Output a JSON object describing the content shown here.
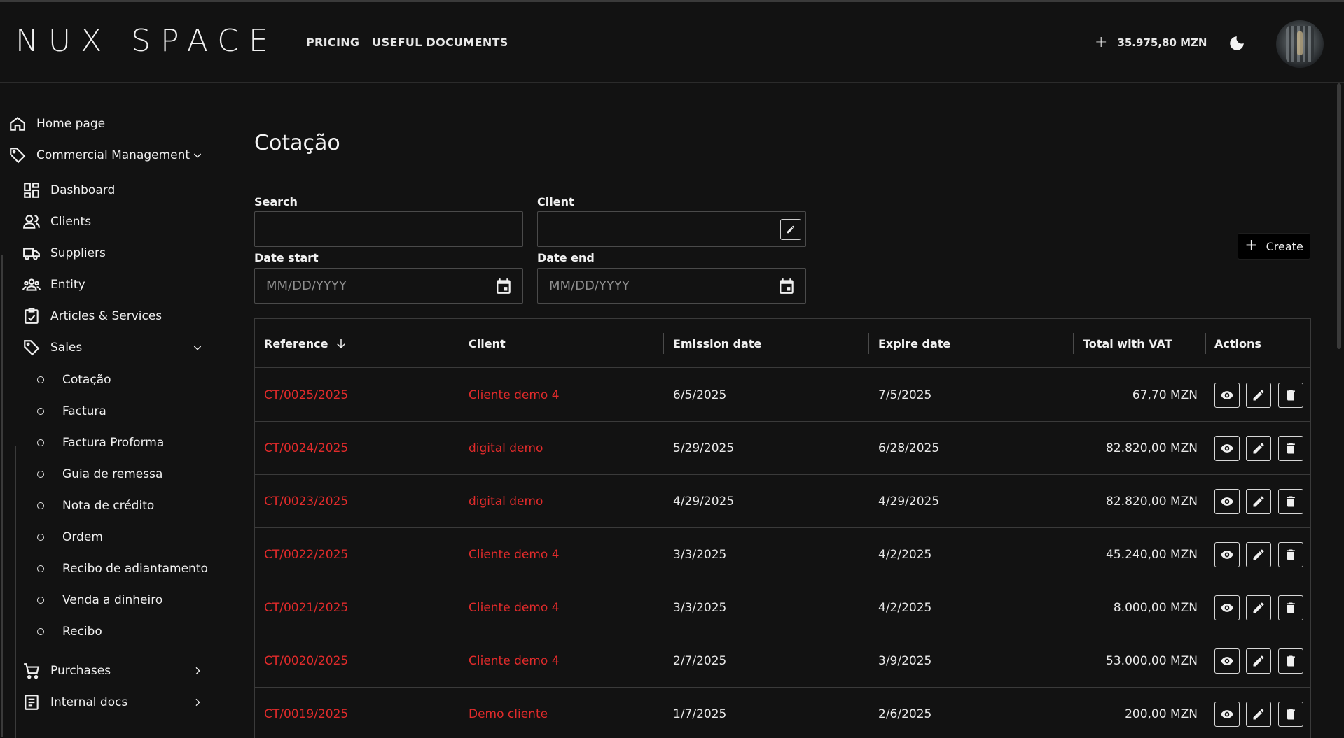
{
  "app": {
    "logo": "NUX SPACE",
    "nav": [
      "PRICING",
      "USEFUL DOCUMENTS"
    ],
    "balance": "35.975,80 MZN"
  },
  "sidebar": {
    "home": "Home page",
    "commercial": "Commercial Management",
    "items": [
      "Dashboard",
      "Clients",
      "Suppliers",
      "Entity",
      "Articles & Services"
    ],
    "sales": "Sales",
    "sales_items": [
      "Cotação",
      "Factura",
      "Factura Proforma",
      "Guia de remessa",
      "Nota de crédito",
      "Ordem",
      "Recibo de adiantamento",
      "Venda a dinheiro",
      "Recibo"
    ],
    "purchases": "Purchases",
    "internal_docs": "Internal docs"
  },
  "page": {
    "title": "Cotação",
    "search_label": "Search",
    "client_label": "Client",
    "date_start_label": "Date start",
    "date_end_label": "Date end",
    "date_placeholder": "MM/DD/YYYY",
    "create_label": "Create"
  },
  "table": {
    "headers": [
      "Reference",
      "Client",
      "Emission date",
      "Expire date",
      "Total with VAT",
      "Actions"
    ],
    "rows": [
      {
        "ref": "CT/0025/2025",
        "client": "Cliente demo 4",
        "emission": "6/5/2025",
        "expire": "7/5/2025",
        "total": "67,70 MZN"
      },
      {
        "ref": "CT/0024/2025",
        "client": "digital demo",
        "emission": "5/29/2025",
        "expire": "6/28/2025",
        "total": "82.820,00 MZN"
      },
      {
        "ref": "CT/0023/2025",
        "client": "digital demo",
        "emission": "4/29/2025",
        "expire": "4/29/2025",
        "total": "82.820,00 MZN"
      },
      {
        "ref": "CT/0022/2025",
        "client": "Cliente demo 4",
        "emission": "3/3/2025",
        "expire": "4/2/2025",
        "total": "45.240,00 MZN"
      },
      {
        "ref": "CT/0021/2025",
        "client": "Cliente demo 4",
        "emission": "3/3/2025",
        "expire": "4/2/2025",
        "total": "8.000,00 MZN"
      },
      {
        "ref": "CT/0020/2025",
        "client": "Cliente demo 4",
        "emission": "2/7/2025",
        "expire": "3/9/2025",
        "total": "53.000,00 MZN"
      },
      {
        "ref": "CT/0019/2025",
        "client": "Demo cliente",
        "emission": "1/7/2025",
        "expire": "2/6/2025",
        "total": "200,00 MZN"
      }
    ]
  },
  "colors": {
    "background": "#121212",
    "accent_red": "#e12b2b",
    "border": "#3a3a3a"
  },
  "icons": [
    "home-icon",
    "tag-icon",
    "dashboard-icon",
    "clients-icon",
    "truck-icon",
    "entity-icon",
    "articles-icon",
    "cart-icon",
    "document-icon",
    "calendar-icon",
    "edit-icon",
    "eye-icon",
    "trash-icon",
    "moon-icon",
    "plus-icon"
  ]
}
